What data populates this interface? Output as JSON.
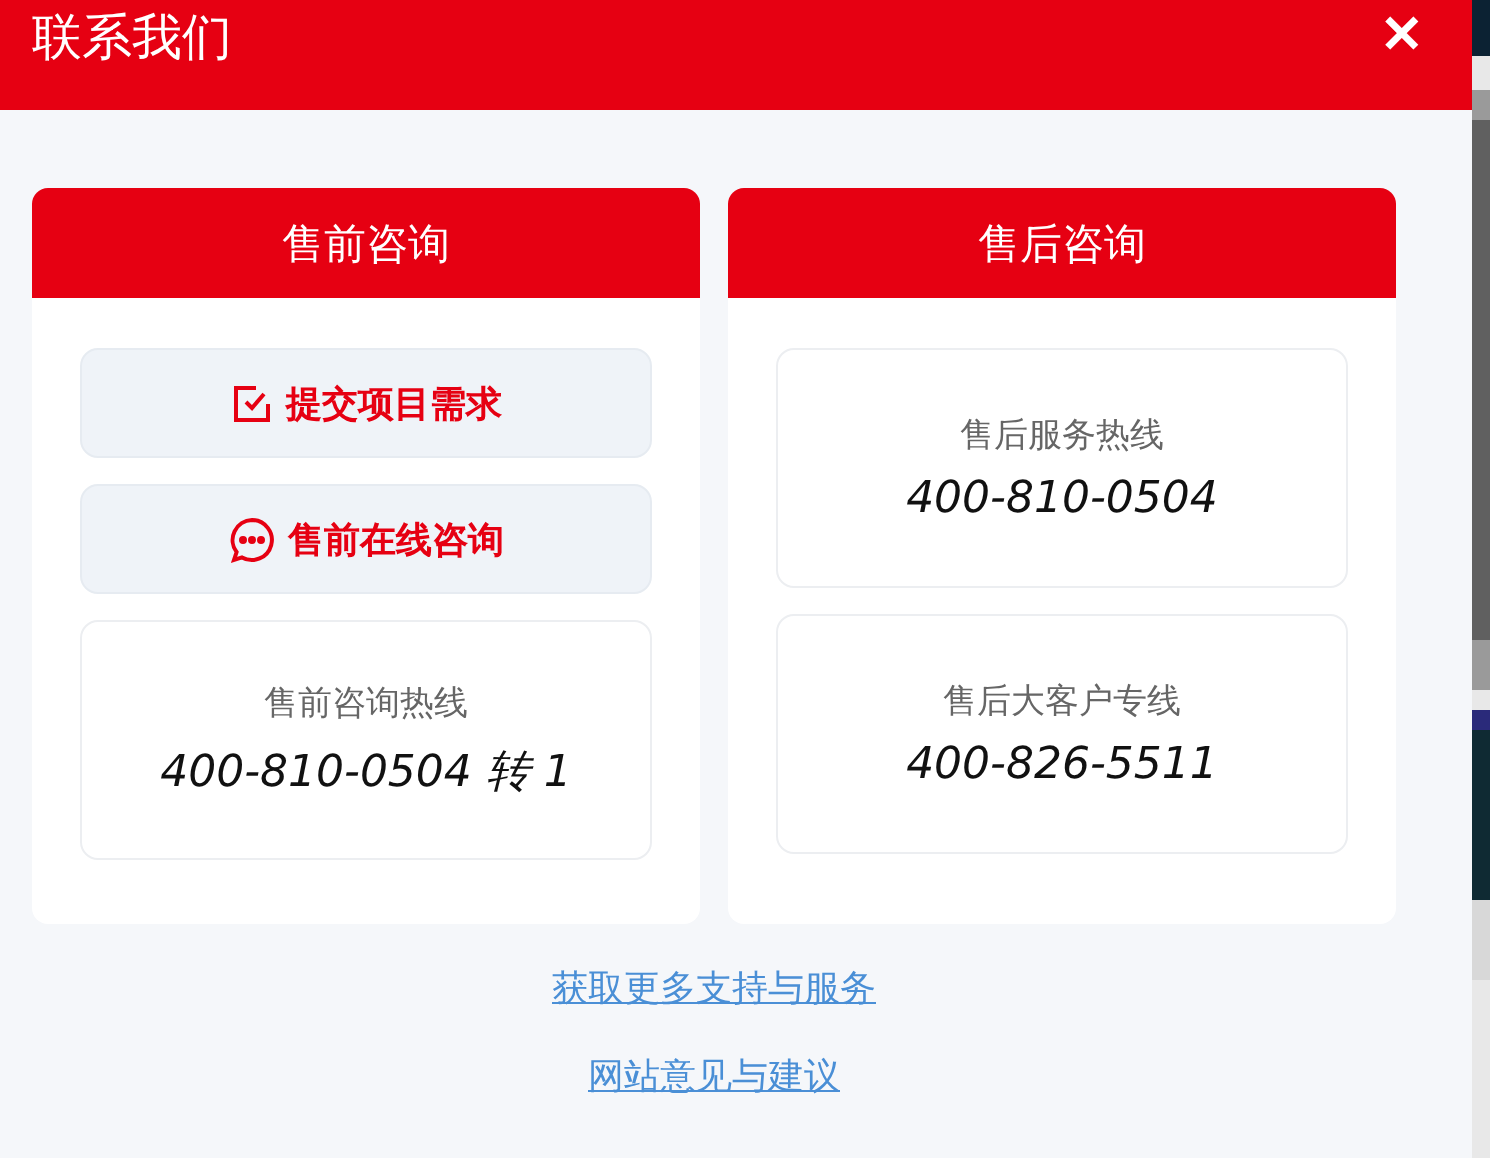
{
  "dialog": {
    "title": "联系我们",
    "close": "✕"
  },
  "panels": [
    {
      "title": "售前咨询",
      "items": [
        {
          "kind": "action",
          "label": "提交项目需求"
        },
        {
          "kind": "action",
          "label": "售前在线咨询"
        },
        {
          "kind": "hotline",
          "label": "售前咨询热线",
          "number": "400-810-0504 转 1"
        }
      ]
    },
    {
      "title": "售后咨询",
      "items": [
        {
          "kind": "hotline",
          "label": "售后服务热线",
          "number": "400-810-0504"
        },
        {
          "kind": "hotline",
          "label": "售后大客户专线",
          "number": "400-826-5511"
        }
      ]
    }
  ],
  "links": [
    "获取更多支持与服务",
    "网站意见与建议"
  ]
}
